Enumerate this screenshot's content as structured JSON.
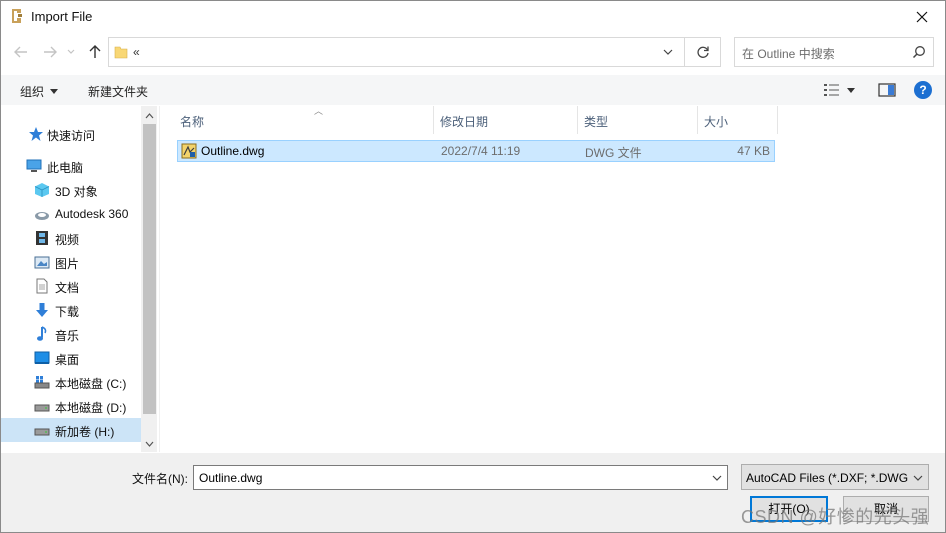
{
  "window": {
    "title": "Import File"
  },
  "address": {
    "path": "«"
  },
  "search": {
    "placeholder": "在 Outline 中搜索"
  },
  "toolbar": {
    "organize": "组织",
    "new_folder": "新建文件夹"
  },
  "nav": {
    "items": [
      {
        "label": "快速访问",
        "icon": "pin-star-icon"
      },
      {
        "label": "此电脑",
        "icon": "pc-icon"
      },
      {
        "label": "3D 对象",
        "icon": "cube-3d-icon"
      },
      {
        "label": "Autodesk 360",
        "icon": "cloud-icon"
      },
      {
        "label": "视频",
        "icon": "film-icon"
      },
      {
        "label": "图片",
        "icon": "picture-icon"
      },
      {
        "label": "文档",
        "icon": "document-icon"
      },
      {
        "label": "下载",
        "icon": "download-arrow-icon"
      },
      {
        "label": "音乐",
        "icon": "music-note-icon"
      },
      {
        "label": "桌面",
        "icon": "desktop-icon"
      },
      {
        "label": "本地磁盘 (C:)",
        "icon": "drive-c-icon"
      },
      {
        "label": "本地磁盘 (D:)",
        "icon": "drive-icon"
      },
      {
        "label": "新加卷 (H:)",
        "icon": "drive-icon",
        "selected": true
      }
    ]
  },
  "columns": {
    "name": "名称",
    "modified": "修改日期",
    "type": "类型",
    "size": "大小"
  },
  "files": [
    {
      "name": "Outline.dwg",
      "modified": "2022/7/4 11:19",
      "type": "DWG 文件",
      "size": "47 KB",
      "selected": true
    }
  ],
  "footer": {
    "filename_label": "文件名(N):",
    "filename_value": "Outline.dwg",
    "filter": "AutoCAD Files (*.DXF; *.DWG",
    "open_button": "打开(O)",
    "cancel_button": "取消"
  },
  "watermark": "CSDN @好惨的先头强"
}
